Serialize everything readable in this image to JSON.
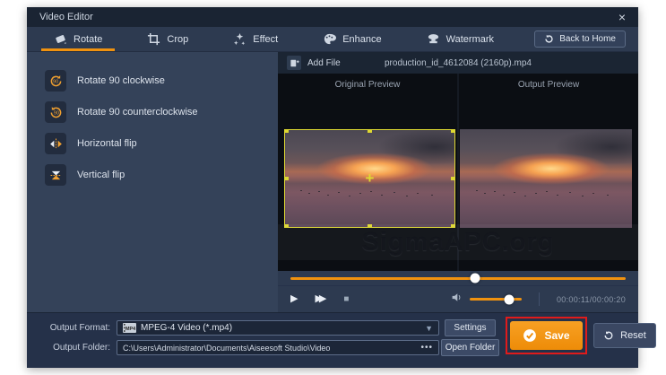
{
  "window": {
    "title": "Video Editor",
    "close_glyph": "×"
  },
  "tabs": [
    {
      "label": "Rotate",
      "active": true
    },
    {
      "label": "Crop",
      "active": false
    },
    {
      "label": "Effect",
      "active": false
    },
    {
      "label": "Enhance",
      "active": false
    },
    {
      "label": "Watermark",
      "active": false
    }
  ],
  "toolbar": {
    "back_home_label": "Back to Home"
  },
  "sidebar": {
    "items": [
      {
        "label": "Rotate 90 clockwise"
      },
      {
        "label": "Rotate 90 counterclockwise"
      },
      {
        "label": "Horizontal flip"
      },
      {
        "label": "Vertical flip"
      }
    ]
  },
  "file_bar": {
    "add_file_label": "Add File",
    "filename": "production_id_4612084 (2160p).mp4"
  },
  "preview": {
    "original_label": "Original Preview",
    "output_label": "Output Preview",
    "watermark_text": "SigmaAPC.org",
    "crosshair_glyph": "+"
  },
  "player": {
    "play_glyph": "▶",
    "fast_forward_glyph": "▶▶",
    "stop_glyph": "■",
    "time": "00:00:11/00:00:20",
    "progress_pct": 55,
    "volume_pct": 75
  },
  "output_bar": {
    "format_label": "Output Format:",
    "format_badge": "MP4",
    "format_value": "MPEG-4 Video (*.mp4)",
    "dropdown_glyph": "▼",
    "settings_label": "Settings",
    "folder_label": "Output Folder:",
    "folder_path": "C:\\Users\\Administrator\\Documents\\Aiseesoft Studio\\Video",
    "browse_label": "•••",
    "open_folder_label": "Open Folder",
    "save_label": "Save",
    "reset_label": "Reset"
  },
  "colors": {
    "accent_orange": "#f0920f",
    "selection_yellow": "#ded832",
    "annotation_red": "#e01b1b",
    "titlebar_bg": "#1a2433",
    "panel_bg": "#344259",
    "bottombar_bg": "#253149"
  }
}
